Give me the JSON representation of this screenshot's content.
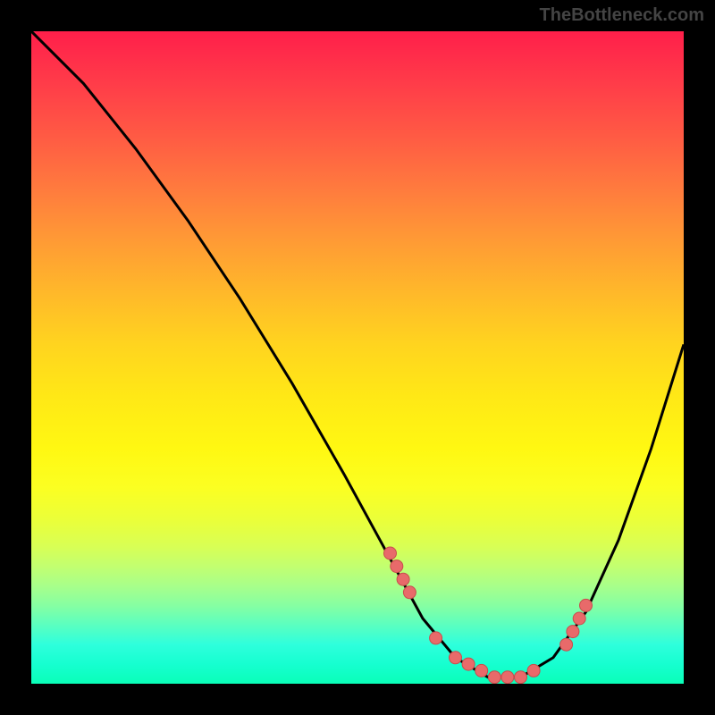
{
  "watermark": "TheBottleneck.com",
  "chart_data": {
    "type": "line",
    "title": "",
    "xlabel": "",
    "ylabel": "",
    "xlim": [
      0,
      100
    ],
    "ylim": [
      0,
      100
    ],
    "curve": {
      "x": [
        0,
        8,
        16,
        24,
        32,
        40,
        48,
        54,
        60,
        65,
        70,
        75,
        80,
        85,
        90,
        95,
        100
      ],
      "y": [
        100,
        92,
        82,
        71,
        59,
        46,
        32,
        21,
        10,
        4,
        1,
        1,
        4,
        11,
        22,
        36,
        52
      ]
    },
    "series": [
      {
        "name": "markers",
        "x": [
          55,
          56,
          57,
          58,
          62,
          65,
          67,
          69,
          71,
          73,
          75,
          77,
          82,
          83,
          84,
          85
        ],
        "y": [
          20,
          18,
          16,
          14,
          7,
          4,
          3,
          2,
          1,
          1,
          1,
          2,
          6,
          8,
          10,
          12
        ]
      }
    ],
    "grid": false,
    "legend": false,
    "colors": {
      "curve": "#000000",
      "marker_fill": "#e86a6a",
      "marker_stroke": "#c84d4d",
      "gradient_top": "#ff1f4a",
      "gradient_bottom": "#0affb8"
    }
  }
}
